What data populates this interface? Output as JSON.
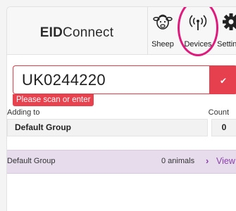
{
  "header": {
    "app_title_bold": "EID",
    "app_title_rest": "Connect",
    "nav": [
      {
        "label": "Sheep",
        "icon": "sheep-icon"
      },
      {
        "label": "Devices",
        "icon": "wifi-signal-icon"
      },
      {
        "label": "Settings",
        "icon": "gear-icon"
      }
    ]
  },
  "scan": {
    "value": "UK0244220",
    "error": "Please scan or enter",
    "submit_icon": "check-icon"
  },
  "group_info": {
    "adding_label": "Adding to",
    "count_label": "Count",
    "group_value": "Default Group",
    "count_value": "0"
  },
  "group_list": [
    {
      "name": "Default Group",
      "animals": "0 animals",
      "action": "View"
    }
  ],
  "colors": {
    "error": "#e6404f",
    "highlight": "#e0197d",
    "group_row_bg": "#e6dcec",
    "link": "#8a3fa8"
  }
}
